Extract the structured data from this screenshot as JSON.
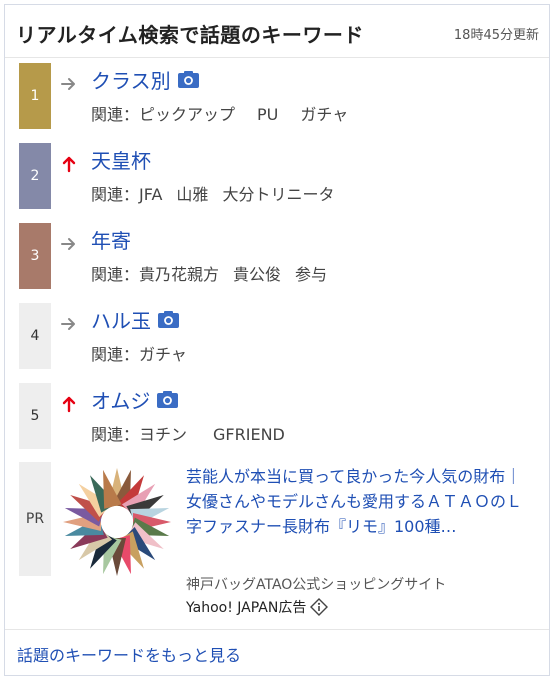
{
  "header": {
    "title": "リアルタイム検索で話題のキーワード",
    "updated": "18時45分更新"
  },
  "keywords": [
    {
      "rank": "1",
      "keyword": "クラス別",
      "related_label": "関連：",
      "related": [
        "ピックアップ",
        "PU",
        "ガチャ"
      ],
      "trend": "flat",
      "camera": true,
      "rank_color": "#b69a4a"
    },
    {
      "rank": "2",
      "keyword": "天皇杯",
      "related_label": "関連：",
      "related": [
        "JFA",
        "山雅",
        "大分トリニータ"
      ],
      "trend": "up",
      "camera": false,
      "rank_color": "#8489a8"
    },
    {
      "rank": "3",
      "keyword": "年寄",
      "related_label": "関連：",
      "related": [
        "貴乃花親方",
        "貴公俊",
        "参与"
      ],
      "trend": "flat",
      "camera": false,
      "rank_color": "#a87a6a"
    },
    {
      "rank": "4",
      "keyword": "ハル玉",
      "related_label": "関連：",
      "related": [
        "ガチャ"
      ],
      "trend": "flat",
      "camera": true,
      "rank_color": "#eeeeee"
    },
    {
      "rank": "5",
      "keyword": "オムジ",
      "related_label": "関連：",
      "related": [
        "ヨチン",
        "GFRIEND"
      ],
      "trend": "up",
      "camera": true,
      "rank_color": "#eeeeee"
    }
  ],
  "pr": {
    "badge": "PR",
    "headline": "芸能人が本当に買って良かった今人気の財布｜ 女優さんやモデルさんも愛用するＡＴＡＯのＬ字ファスナー長財布『リモ』100種…",
    "sponsor": "神戸バッグATAO公式ショッピングサイト",
    "ad_label": "Yahoo! JAPAN広告"
  },
  "footer": {
    "more_link": "話題のキーワードをもっと見る"
  },
  "colors": {
    "link": "#1f4fb4",
    "up_arrow": "#e60012",
    "flat_arrow": "#888888",
    "camera": "#3a6cc4"
  }
}
